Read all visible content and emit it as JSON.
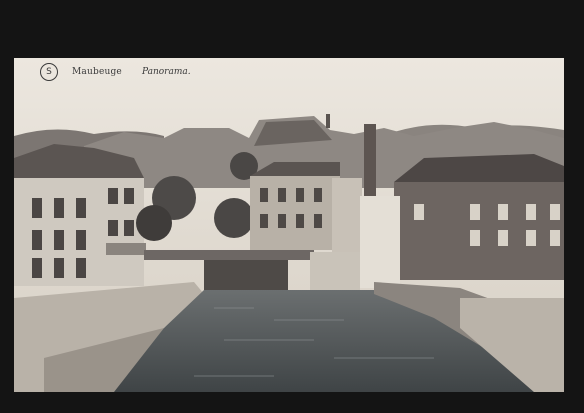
{
  "postcard": {
    "place": "Maubeuge",
    "title": "Panorama.",
    "publisher_mark": "S"
  },
  "colors": {
    "sky": "#d9d3c8",
    "buildings_dark": "#4a4543",
    "buildings_mid": "#6f6864",
    "buildings_light": "#b7b0a6",
    "water": "#555b5e",
    "frame": "#141414"
  }
}
